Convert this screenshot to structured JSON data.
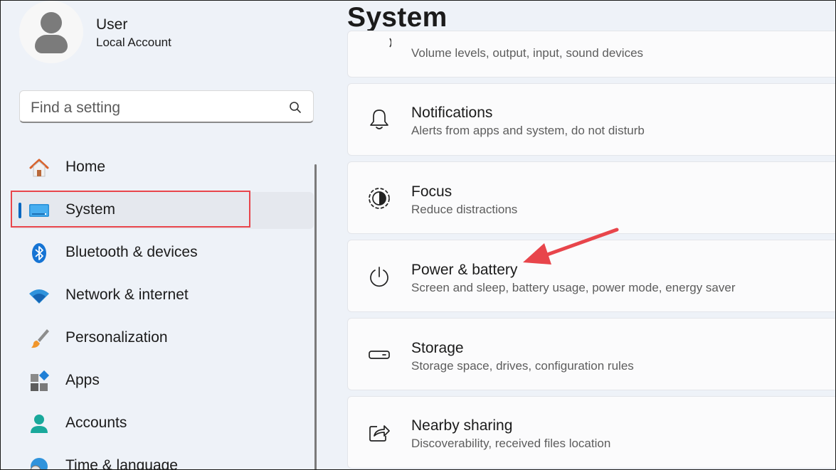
{
  "user": {
    "name": "User",
    "account_type": "Local Account"
  },
  "search": {
    "placeholder": "Find a setting"
  },
  "sidebar": {
    "items": [
      {
        "label": "Home",
        "icon": "home-icon"
      },
      {
        "label": "System",
        "icon": "system-display-icon",
        "selected": true
      },
      {
        "label": "Bluetooth & devices",
        "icon": "bluetooth-icon"
      },
      {
        "label": "Network & internet",
        "icon": "wifi-icon"
      },
      {
        "label": "Personalization",
        "icon": "paintbrush-icon"
      },
      {
        "label": "Apps",
        "icon": "apps-icon"
      },
      {
        "label": "Accounts",
        "icon": "person-icon"
      },
      {
        "label": "Time & language",
        "icon": "globe-clock-icon"
      }
    ]
  },
  "main": {
    "title": "System",
    "cards": [
      {
        "title": "",
        "description": "Volume levels, output, input, sound devices",
        "icon": "speaker-icon"
      },
      {
        "title": "Notifications",
        "description": "Alerts from apps and system, do not disturb",
        "icon": "bell-icon"
      },
      {
        "title": "Focus",
        "description": "Reduce distractions",
        "icon": "focus-icon"
      },
      {
        "title": "Power & battery",
        "description": "Screen and sleep, battery usage, power mode, energy saver",
        "icon": "power-icon"
      },
      {
        "title": "Storage",
        "description": "Storage space, drives, configuration rules",
        "icon": "storage-drive-icon"
      },
      {
        "title": "Nearby sharing",
        "description": "Discoverability, received files location",
        "icon": "share-icon"
      }
    ]
  },
  "colors": {
    "accent": "#0067c0",
    "annotation_red": "#e8454b",
    "background": "#eef2f8"
  }
}
